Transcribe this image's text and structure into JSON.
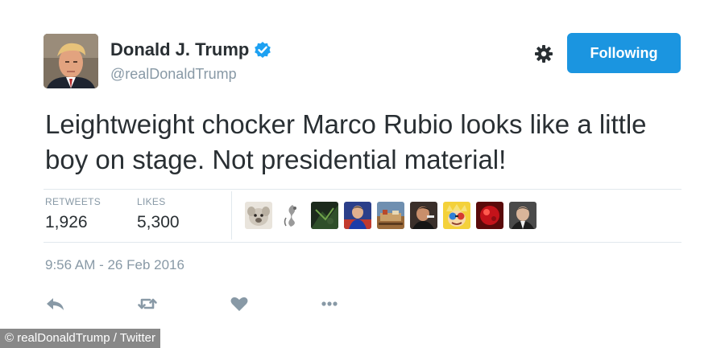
{
  "user": {
    "display_name": "Donald J. Trump",
    "handle": "@realDonaldTrump",
    "verified": true,
    "avatar": "profile-photo"
  },
  "header": {
    "follow_label": "Following",
    "gear_icon": "gear-icon"
  },
  "tweet": {
    "text": "Leightweight chocker Marco Rubio looks like a little boy on stage. Not presidential material!",
    "timestamp": "9:56 AM - 26 Feb 2016"
  },
  "stats": {
    "retweets_label": "RETWEETS",
    "retweets_value": "1,926",
    "likes_label": "LIKES",
    "likes_value": "5,300"
  },
  "likers": [
    {
      "name": "liker-avatar-1"
    },
    {
      "name": "liker-avatar-2"
    },
    {
      "name": "liker-avatar-3"
    },
    {
      "name": "liker-avatar-4"
    },
    {
      "name": "liker-avatar-5"
    },
    {
      "name": "liker-avatar-6"
    },
    {
      "name": "liker-avatar-7"
    },
    {
      "name": "liker-avatar-8"
    },
    {
      "name": "liker-avatar-9"
    }
  ],
  "actions": [
    "reply-icon",
    "retweet-icon",
    "like-icon",
    "more-icon"
  ],
  "credit": "© realDonaldTrump / Twitter",
  "colors": {
    "accent": "#1b95e0",
    "text": "#292f33",
    "muted": "#8899a6",
    "divider": "#e1e8ed",
    "action_icon": "#8899a6"
  }
}
